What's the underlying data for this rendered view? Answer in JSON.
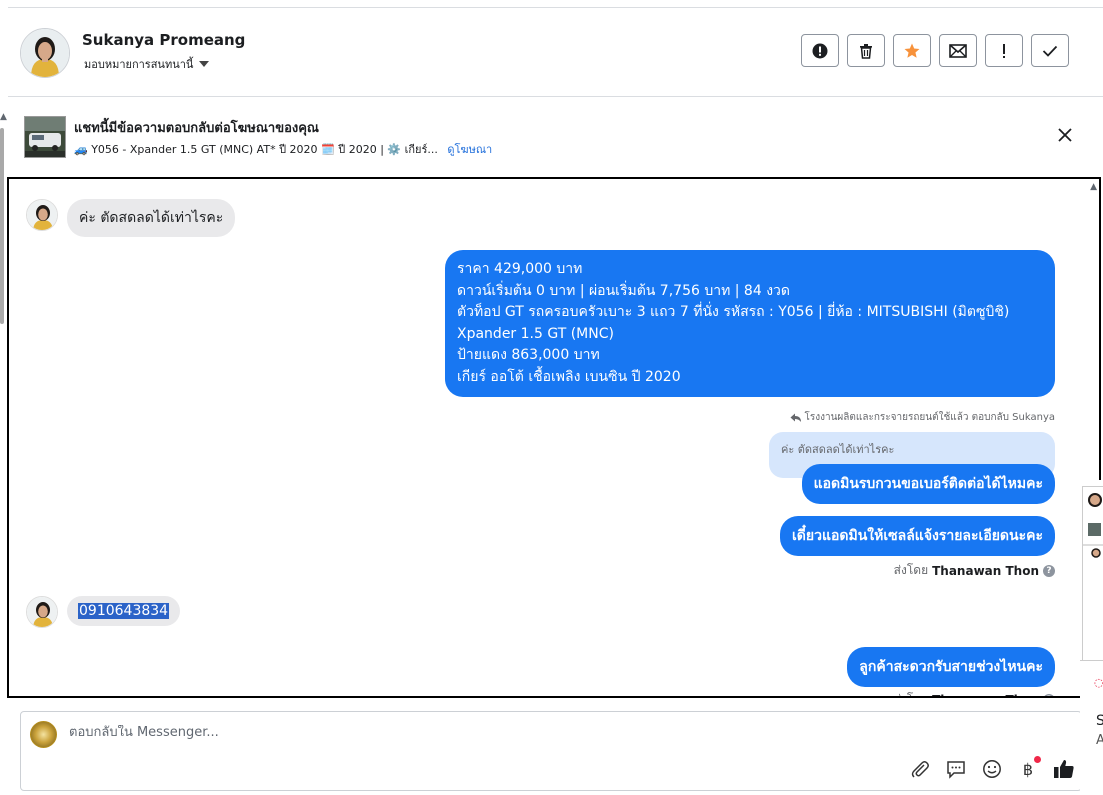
{
  "contact": {
    "name": "Sukanya Promeang",
    "assign_label": "มอบหมายการสนทนานี้"
  },
  "actions": [
    {
      "name": "mark-spam-button",
      "glyph": "!"
    },
    {
      "name": "delete-button",
      "glyph": "trash"
    },
    {
      "name": "star-button",
      "glyph": "star"
    },
    {
      "name": "mark-unread-button",
      "glyph": "envelope"
    },
    {
      "name": "follow-up-button",
      "glyph": "!"
    },
    {
      "name": "mark-done-button",
      "glyph": "check"
    }
  ],
  "ad": {
    "title": "แชทนี้มีข้อความตอบกลับต่อโฆษณาของคุณ",
    "subtitle": "🚙 Y056 - Xpander 1.5 GT (MNC) AT* ปี 2020 🗓️ ปี 2020 | ⚙️ เกียร์...",
    "link": "ดูโฆษณา"
  },
  "messages": {
    "incoming_1": "ค่ะ ตัดสดลดได้เท่าไรคะ",
    "price_lines": [
      "ราคา 429,000 บาท",
      "ดาวน์เริ่มต้น 0 บาท | ผ่อนเริ่มต้น 7,756 บาท | 84 งวด",
      " ตัวท็อป GT รถครอบครัวเบาะ 3 แถว 7 ที่นั่ง  รหัสรถ : Y056 |  ยี่ห้อ : MITSUBISHI (มิตซูบิชิ)",
      "Xpander 1.5 GT (MNC)",
      " ป้ายแดง 863,000 บาท",
      " เกียร์ ออโต้  เชื้อเพลิง เบนซิน  ปี 2020"
    ],
    "reply_meta": "โรงงานผลิตและกระจายรถยนต์ใช้แล้ว ตอบกลับ Sukanya",
    "quoted": "ค่ะ ตัดสดลดได้เท่าไรคะ",
    "outgoing_1": "แอดมินรบกวนขอเบอร์ติดต่อได้ไหมคะ",
    "outgoing_2": "เดี๋ยวแอดมินให้เซลล์แจ้งรายละเอียดนะคะ",
    "sent_by_prefix": "ส่งโดย",
    "sent_by_name": "Thanawan Thon",
    "incoming_phone": "0910643834",
    "outgoing_3": "ลูกค้าสะดวกรับสายช่วงไหนคะ"
  },
  "composer": {
    "placeholder": "ตอบกลับใน Messenger..."
  },
  "tools": {
    "currency_symbol": "฿"
  },
  "peek": {
    "s": "S",
    "a": "A"
  },
  "colors": {
    "brand_blue": "#1877f2",
    "incoming_gray": "#e9e9eb",
    "star_orange": "#f7923b",
    "link_blue": "#216fdb"
  }
}
